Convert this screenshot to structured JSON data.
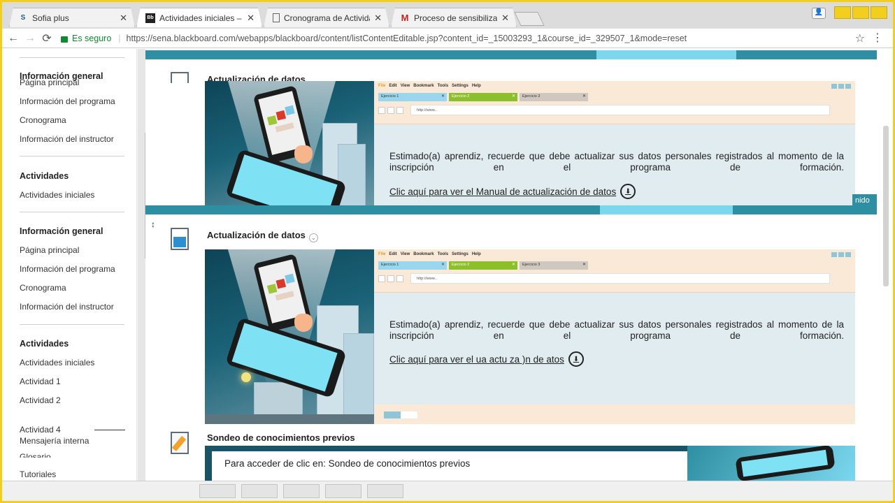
{
  "tabs": [
    {
      "title": "Sofia plus",
      "icon": "S"
    },
    {
      "title": "Actividades iniciales – D",
      "icon": "Bb"
    },
    {
      "title": "Cronograma de Activida",
      "icon": ""
    },
    {
      "title": "Proceso de sensibilizació",
      "icon": "M"
    }
  ],
  "toolbar": {
    "secure_label": "Es seguro",
    "url": "https://sena.blackboard.com/webapps/blackboard/content/listContentEditable.jsp?content_id=_15003293_1&course_id=_329507_1&mode=reset"
  },
  "menu": {
    "ghost": {
      "heading": "Información general",
      "overlap": "Página principal",
      "items": [
        "Información del programa",
        "Cronograma",
        "Información del instructor"
      ],
      "act_heading": "Actividades",
      "act_items": [
        "Actividades iniciales"
      ]
    },
    "main": {
      "heading": "Información general",
      "items": [
        "Página principal",
        "Información del programa",
        "Cronograma",
        "Información del instructor"
      ],
      "act_heading": "Actividades",
      "act_items": [
        "Actividades iniciales",
        "Actividad 1",
        "Actividad 2"
      ],
      "actividad4": "Actividad 4",
      "mensajeria": "Mensajería interna",
      "glosario": "Glosario",
      "tutoriales": "Tutoriales"
    }
  },
  "items": [
    {
      "title": "Actualización de datos",
      "message": "Estimado(a) aprendiz, recuerde que debe actualizar sus datos personales registrados al momento de la inscripción en el programa de formación.",
      "link": "Clic aquí para ver el Manual de actualización de datos"
    },
    {
      "title": "Actualización de datos",
      "message": "Estimado(a) aprendiz, recuerde que debe actualizar sus datos personales registrados al momento de la inscripción en el programa de formación.",
      "link": "Clic aquí para ver el     ua      actu  za  )n de  atos"
    },
    {
      "title": "Sondeo de conocimientos previos",
      "message": "Para acceder de clic en: Sondeo de conocimientos previos"
    }
  ],
  "banner_browser": {
    "menu": [
      "File",
      "Edit",
      "View",
      "Bookmark",
      "Tools",
      "Settings",
      "Help"
    ],
    "tabs": [
      "Ejercicio 1",
      "Ejercicio 2",
      "Ejercicio 3"
    ],
    "url": "http://www..."
  },
  "right_cut_text": "nido",
  "colors": {
    "stripe": "#2f8fa2",
    "stripe_light": "#7bd7ee",
    "banner_peach": "#fbe9d7",
    "frame": "#f2cf1f"
  }
}
